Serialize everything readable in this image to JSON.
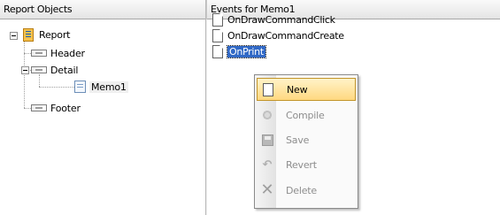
{
  "left_pane": {
    "header": "Report Objects"
  },
  "right_pane": {
    "header": "Events for Memo1"
  },
  "tree": {
    "root": "Report",
    "header_band": "Header",
    "detail_band": "Detail",
    "memo": "Memo1",
    "footer_band": "Footer"
  },
  "events": [
    {
      "label": "OnDrawCommandClick"
    },
    {
      "label": "OnDrawCommandCreate"
    },
    {
      "label": "OnPrint",
      "selected": true
    }
  ],
  "context_menu": {
    "items": [
      {
        "label": "New",
        "icon": "new-document-icon",
        "enabled": true,
        "highlighted": true
      },
      {
        "label": "Compile",
        "icon": "compile-icon",
        "enabled": false
      },
      {
        "label": "Save",
        "icon": "save-icon",
        "enabled": false
      },
      {
        "label": "Revert",
        "icon": "revert-icon",
        "enabled": false
      },
      {
        "label": "Delete",
        "icon": "delete-icon",
        "enabled": false
      }
    ]
  },
  "colors": {
    "selection": "#3169c6",
    "menu_highlight": "#ffd880",
    "disabled_text": "#8d8d8d"
  }
}
